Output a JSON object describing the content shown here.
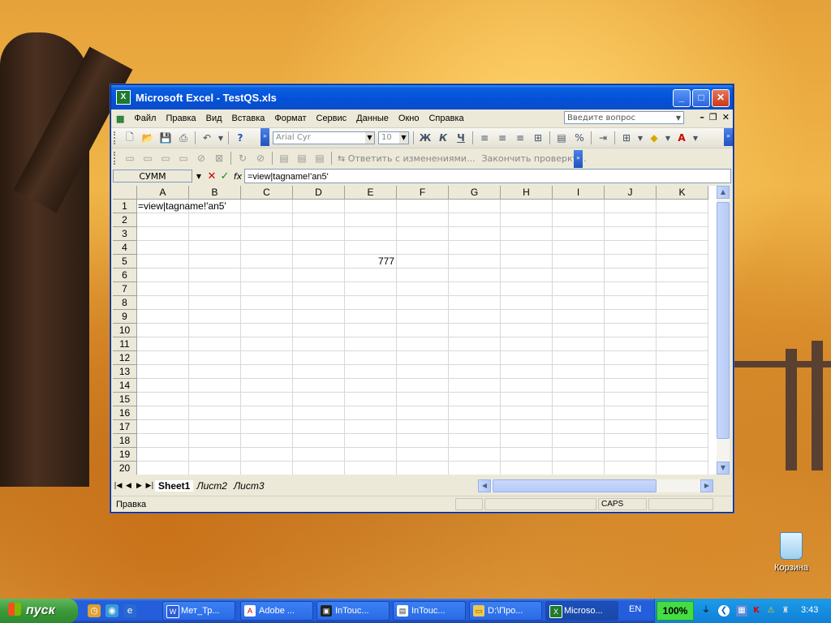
{
  "window": {
    "title": "Microsoft Excel - TestQS.xls",
    "minimize": "_",
    "maximize": "□",
    "close": "✕"
  },
  "menubar": {
    "items": [
      "Файл",
      "Правка",
      "Вид",
      "Вставка",
      "Формат",
      "Сервис",
      "Данные",
      "Окно",
      "Справка"
    ],
    "ask_placeholder": "Введите вопрос"
  },
  "toolbar_format": {
    "font": "Arial Cyr",
    "size": "10",
    "bold": "Ж",
    "italic": "К",
    "underline": "Ч",
    "percent": "%"
  },
  "toolbar_review": {
    "reply_changes": "Ответить с изменениями...",
    "end_review": "Закончить проверку..."
  },
  "formula_bar": {
    "name_box": "СУММ",
    "cancel": "✕",
    "enter": "✓",
    "fx": "fx",
    "formula": "=view|tagname!'an5'"
  },
  "grid": {
    "columns": [
      "A",
      "B",
      "C",
      "D",
      "E",
      "F",
      "G",
      "H",
      "I",
      "J",
      "K"
    ],
    "rows": [
      "1",
      "2",
      "3",
      "4",
      "5",
      "6",
      "7",
      "8",
      "9",
      "10",
      "11",
      "12",
      "13",
      "14",
      "15",
      "16",
      "17",
      "18",
      "19",
      "20"
    ],
    "cells": {
      "A1": "=view|tagname!'an5'",
      "E5": "777"
    }
  },
  "sheets": {
    "tabs": [
      "Sheet1",
      "Лист2",
      "Лист3"
    ],
    "active": "Sheet1"
  },
  "statusbar": {
    "mode": "Правка",
    "caps": "CAPS"
  },
  "desktop": {
    "recycle_bin": "Корзина"
  },
  "taskbar": {
    "start": "пуск",
    "buttons": [
      "Мет_Тр...",
      "Adobe ...",
      "InTouc...",
      "InTouc...",
      "D:\\Про...",
      "Microso..."
    ],
    "lang": "EN",
    "battery": "100%",
    "clock": "3:43"
  },
  "colors": {
    "titlebar": "#0450d8",
    "taskbar": "#245edb",
    "start": "#3c9a3a"
  }
}
